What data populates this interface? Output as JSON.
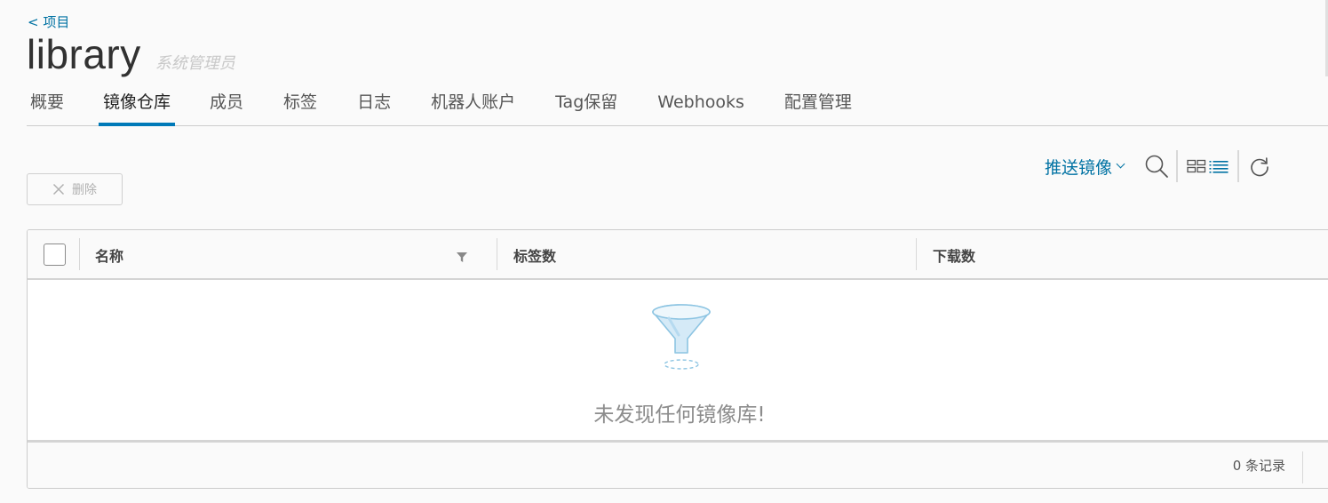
{
  "breadcrumb": {
    "back_label": "< 项目"
  },
  "project": {
    "name": "library",
    "role": "系统管理员"
  },
  "tabs": [
    {
      "label": "概要",
      "active": false
    },
    {
      "label": "镜像仓库",
      "active": true
    },
    {
      "label": "成员",
      "active": false
    },
    {
      "label": "标签",
      "active": false
    },
    {
      "label": "日志",
      "active": false
    },
    {
      "label": "机器人账户",
      "active": false
    },
    {
      "label": "Tag保留",
      "active": false
    },
    {
      "label": "Webhooks",
      "active": false
    },
    {
      "label": "配置管理",
      "active": false
    }
  ],
  "toolbar": {
    "push_image_label": "推送镜像",
    "delete_label": "删除",
    "icons": [
      "search-icon",
      "card-view-icon",
      "list-view-icon",
      "refresh-icon"
    ]
  },
  "table": {
    "columns": [
      "名称",
      "标签数",
      "下载数"
    ],
    "empty_message": "未发现任何镜像库!",
    "record_count": "0 条记录"
  },
  "colors": {
    "link": "#0072a3",
    "active_tab_underline": "#0079b8",
    "border": "#cccccc",
    "muted_text": "#8c8c8c"
  }
}
